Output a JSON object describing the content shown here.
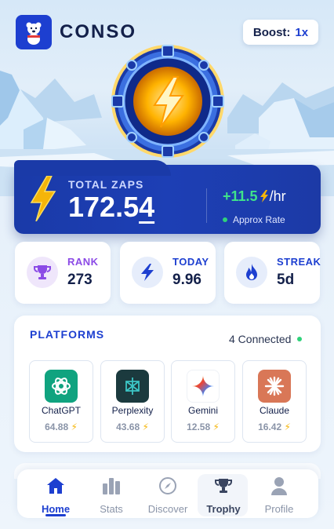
{
  "app": {
    "title": "CONSO"
  },
  "header": {
    "boost_label": "Boost:",
    "boost_value": "1x"
  },
  "total": {
    "label": "TOTAL ZAPS",
    "value_main": "172.5",
    "value_last": "4",
    "rate": "+11.5",
    "rate_unit": "/hr",
    "rate_label": "Approx Rate"
  },
  "stats": [
    {
      "label": "RANK",
      "value": "273",
      "icon": "trophy-icon",
      "color": "#8b4ae6"
    },
    {
      "label": "TODAY",
      "value": "9.96",
      "icon": "bolt-icon",
      "color": "#1d3fd0"
    },
    {
      "label": "STREAK",
      "value": "5d",
      "icon": "flame-icon",
      "color": "#1d3fd0"
    }
  ],
  "platforms": {
    "title": "PLATFORMS",
    "connected": "4 Connected",
    "items": [
      {
        "name": "ChatGPT",
        "value": "64.88",
        "icon": "chatgpt-icon",
        "color": "#10a37f"
      },
      {
        "name": "Perplexity",
        "value": "43.68",
        "icon": "perplexity-icon",
        "color": "#1b3a3e"
      },
      {
        "name": "Gemini",
        "value": "12.58",
        "icon": "gemini-icon",
        "color": "#ffffff"
      },
      {
        "name": "Claude",
        "value": "16.42",
        "icon": "claude-icon",
        "color": "#d97757"
      }
    ]
  },
  "nav": [
    {
      "label": "Home",
      "icon": "home-icon"
    },
    {
      "label": "Stats",
      "icon": "stats-icon"
    },
    {
      "label": "Discover",
      "icon": "compass-icon"
    },
    {
      "label": "Trophy",
      "icon": "trophy-icon"
    },
    {
      "label": "Profile",
      "icon": "profile-icon"
    }
  ],
  "colors": {
    "brand": "#1d3fd0",
    "accent_green": "#3fe38a",
    "bolt": "#f5b50a"
  }
}
